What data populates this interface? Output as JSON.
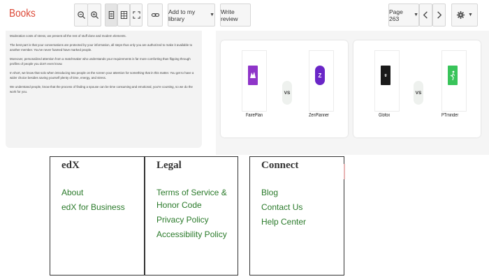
{
  "toolbar": {
    "brand": "Books",
    "add_to_library": "Add to my library",
    "write_review": "Write review",
    "page_label": "Page 263"
  },
  "text_panel": {
    "paragraphs": [
      "Moderation costs of stress, we present all the rest of stuff done and modern elements.",
      "The best part is that your conversations are protected by your information, all steps thus only you are authorized to make it available to another member. You've never foamed have marked people.",
      "Moreover, personalized attention from a matchmaker who understands your requirements is far more comforting than flipping through profiles of people you don't even know.",
      "In short, we know that solo when introducing two people on the screen your attention for something that in this matter. You get to have a wider choice besides saving yourself plenty of time, energy, and stress.",
      "We understand people, know that the process of finding a spouse can be time consuming and emotional, you're counting, so we do the work for you."
    ]
  },
  "comparisons": [
    {
      "left": {
        "name": "FairePlan",
        "icon": "purple-shape-icon",
        "color": "#8f35c9"
      },
      "vs": "VS",
      "right": {
        "name": "ZenPlanner",
        "icon": "z-logo-icon",
        "color": "#6a26c7"
      }
    },
    {
      "left": {
        "name": "Glofox",
        "icon": "glofox-logo-icon",
        "color": "#1a1a1a"
      },
      "vs": "VS",
      "right": {
        "name": "PTminder",
        "icon": "runner-icon",
        "color": "#39c45a"
      }
    }
  ],
  "footer": {
    "columns": [
      {
        "title": "edX",
        "links": [
          "About",
          "edX for Business"
        ]
      },
      {
        "title": "Legal",
        "links": [
          "Terms of Service &\nHonor Code",
          "Privacy Policy",
          "Accessibility Policy"
        ]
      },
      {
        "title": "Connect",
        "links": [
          "Blog",
          "Contact Us",
          "Help Center"
        ]
      }
    ]
  },
  "colors": {
    "brand": "#dd4b39",
    "link": "#2a7a2a"
  }
}
